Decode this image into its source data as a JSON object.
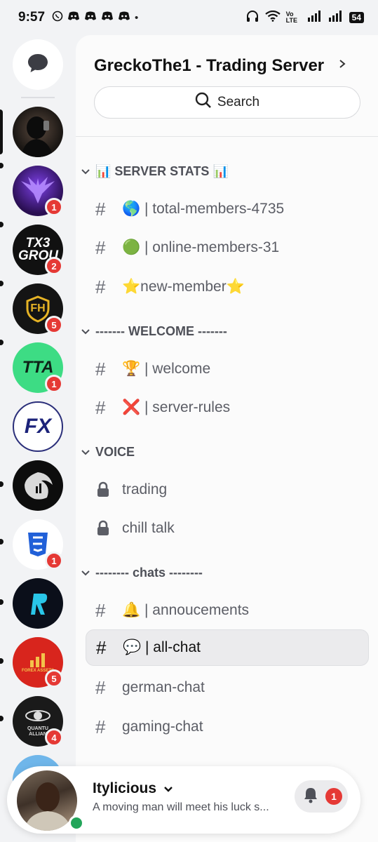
{
  "status_bar": {
    "time": "9:57",
    "notification_icons": [
      "whatsapp-icon",
      "discord-icon",
      "discord-icon",
      "discord-icon",
      "discord-icon",
      "dot-icon"
    ],
    "system_icons": [
      "headphones-icon",
      "wifi-icon",
      "volte-icon",
      "signal-icon",
      "signal-icon"
    ],
    "volte_label": "Vo LTE",
    "battery": "54"
  },
  "rail": {
    "servers": [
      {
        "name": "avatar-server",
        "badge": "",
        "active": true,
        "color": "#2b2b2b",
        "label": ""
      },
      {
        "name": "phoenix-server",
        "badge": "1",
        "color": "#2a0f52",
        "label": ""
      },
      {
        "name": "tx3-group",
        "badge": "2",
        "color": "#111111",
        "label": "TX3 GROU"
      },
      {
        "name": "fundedhive-server",
        "badge": "5",
        "color": "#141414",
        "label": "FH"
      },
      {
        "name": "tta-server",
        "badge": "1",
        "color": "#3ddc84",
        "label": "TTA"
      },
      {
        "name": "fx-server",
        "badge": "",
        "color": "#ffffff",
        "label": "FX"
      },
      {
        "name": "eagle-server",
        "badge": "",
        "color": "#0d0d0d",
        "label": ""
      },
      {
        "name": "css-server",
        "badge": "1",
        "color": "#ffffff",
        "label": ""
      },
      {
        "name": "r-server",
        "badge": "",
        "color": "#0b0f1a",
        "label": ""
      },
      {
        "name": "forex-assets",
        "badge": "5",
        "color": "#d8251d",
        "label": "FOREX ASSETS"
      },
      {
        "name": "quantum-alliance",
        "badge": "4",
        "color": "#1a1a1a",
        "label": "QUANTU ALLIAN"
      }
    ]
  },
  "panel": {
    "server_name": "GreckoThe1 - Trading Server",
    "search_label": "Search",
    "categories": [
      {
        "label": "📊 SERVER STATS 📊"
      },
      {
        "label": "------- WELCOME -------"
      },
      {
        "label": "VOICE"
      },
      {
        "label": "-------- chats --------"
      }
    ],
    "channels": [
      {
        "name": "🌎 | total-members-4735",
        "type": "text"
      },
      {
        "name": "🟢 | online-members-31",
        "type": "text"
      },
      {
        "name": "⭐new-member⭐",
        "type": "text"
      },
      {
        "name": "🏆 | welcome",
        "type": "text"
      },
      {
        "name": "❌ | server-rules",
        "type": "text"
      },
      {
        "name": "trading",
        "type": "voice-locked"
      },
      {
        "name": "chill talk",
        "type": "voice-locked"
      },
      {
        "name": "🔔 | annoucements",
        "type": "text"
      },
      {
        "name": "💬 | all-chat",
        "type": "text",
        "selected": true
      },
      {
        "name": "german-chat",
        "type": "text"
      },
      {
        "name": "gaming-chat",
        "type": "text"
      }
    ]
  },
  "user": {
    "username": "Itylicious",
    "status": "A moving man will meet his luck s...",
    "online": true,
    "inbox_count": "1"
  },
  "colors": {
    "background": "#f2f3f5",
    "panel": "#fbfbfb",
    "badge": "#e53935",
    "online": "#23a55a",
    "selected_channel": "#ebebed"
  }
}
